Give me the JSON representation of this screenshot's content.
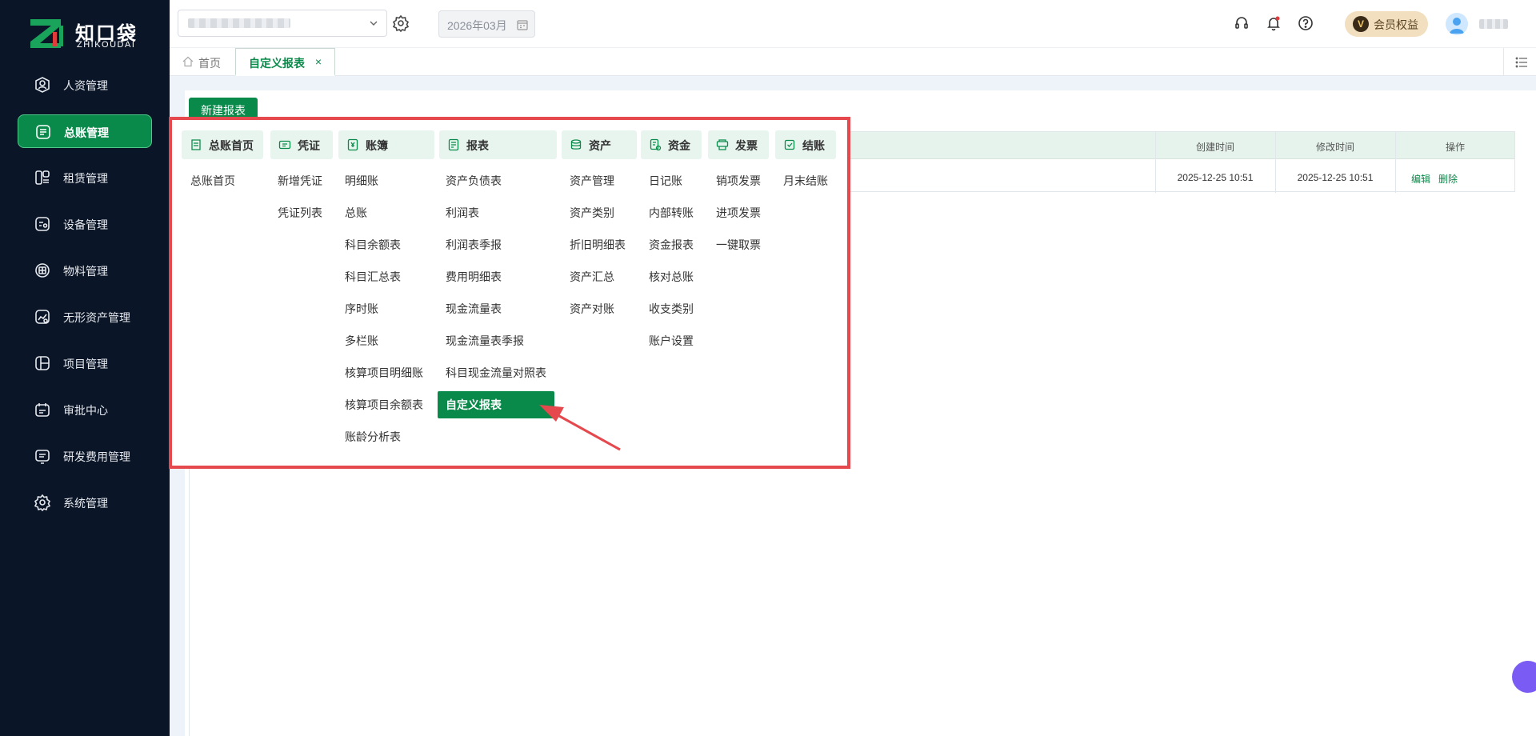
{
  "brand": {
    "name": "知口袋",
    "sub": "ZHIKOUDAI"
  },
  "sidebar": {
    "items": [
      {
        "label": "人资管理"
      },
      {
        "label": "总账管理"
      },
      {
        "label": "租赁管理"
      },
      {
        "label": "设备管理"
      },
      {
        "label": "物料管理"
      },
      {
        "label": "无形资产管理"
      },
      {
        "label": "项目管理"
      },
      {
        "label": "审批中心"
      },
      {
        "label": "研发费用管理"
      },
      {
        "label": "系统管理"
      }
    ],
    "active_index": 1
  },
  "topbar": {
    "period": "2026年03月",
    "vip_label": "会员权益",
    "vip_badge": "V"
  },
  "tabs": [
    {
      "label": "首页"
    },
    {
      "label": "自定义报表",
      "close": "×"
    }
  ],
  "toolbar": {
    "new_label": "新建报表"
  },
  "table": {
    "columns": [
      "创建时间",
      "修改时间",
      "操作"
    ],
    "rows": [
      {
        "created": "2025-12-25 10:51",
        "modified": "2025-12-25 10:51",
        "edit": "编辑",
        "delete": "删除"
      }
    ]
  },
  "mega_menu": {
    "columns": [
      {
        "title": "总账首页",
        "items": [
          "总账首页"
        ]
      },
      {
        "title": "凭证",
        "items": [
          "新增凭证",
          "凭证列表"
        ]
      },
      {
        "title": "账簿",
        "items": [
          "明细账",
          "总账",
          "科目余额表",
          "科目汇总表",
          "序时账",
          "多栏账",
          "核算项目明细账",
          "核算项目余额表",
          "账龄分析表"
        ]
      },
      {
        "title": "报表",
        "items": [
          "资产负债表",
          "利润表",
          "利润表季报",
          "费用明细表",
          "现金流量表",
          "现金流量表季报",
          "科目现金流量对照表",
          "自定义报表"
        ]
      },
      {
        "title": "资产",
        "items": [
          "资产管理",
          "资产类别",
          "折旧明细表",
          "资产汇总",
          "资产对账"
        ]
      },
      {
        "title": "资金",
        "items": [
          "日记账",
          "内部转账",
          "资金报表",
          "核对总账",
          "收支类别",
          "账户设置"
        ]
      },
      {
        "title": "发票",
        "items": [
          "销项发票",
          "进项发票",
          "一键取票"
        ]
      },
      {
        "title": "结账",
        "items": [
          "月末结账"
        ]
      }
    ],
    "active_item": "自定义报表",
    "accent": "#0a8a4a",
    "highlight_border": "#e5484d"
  }
}
